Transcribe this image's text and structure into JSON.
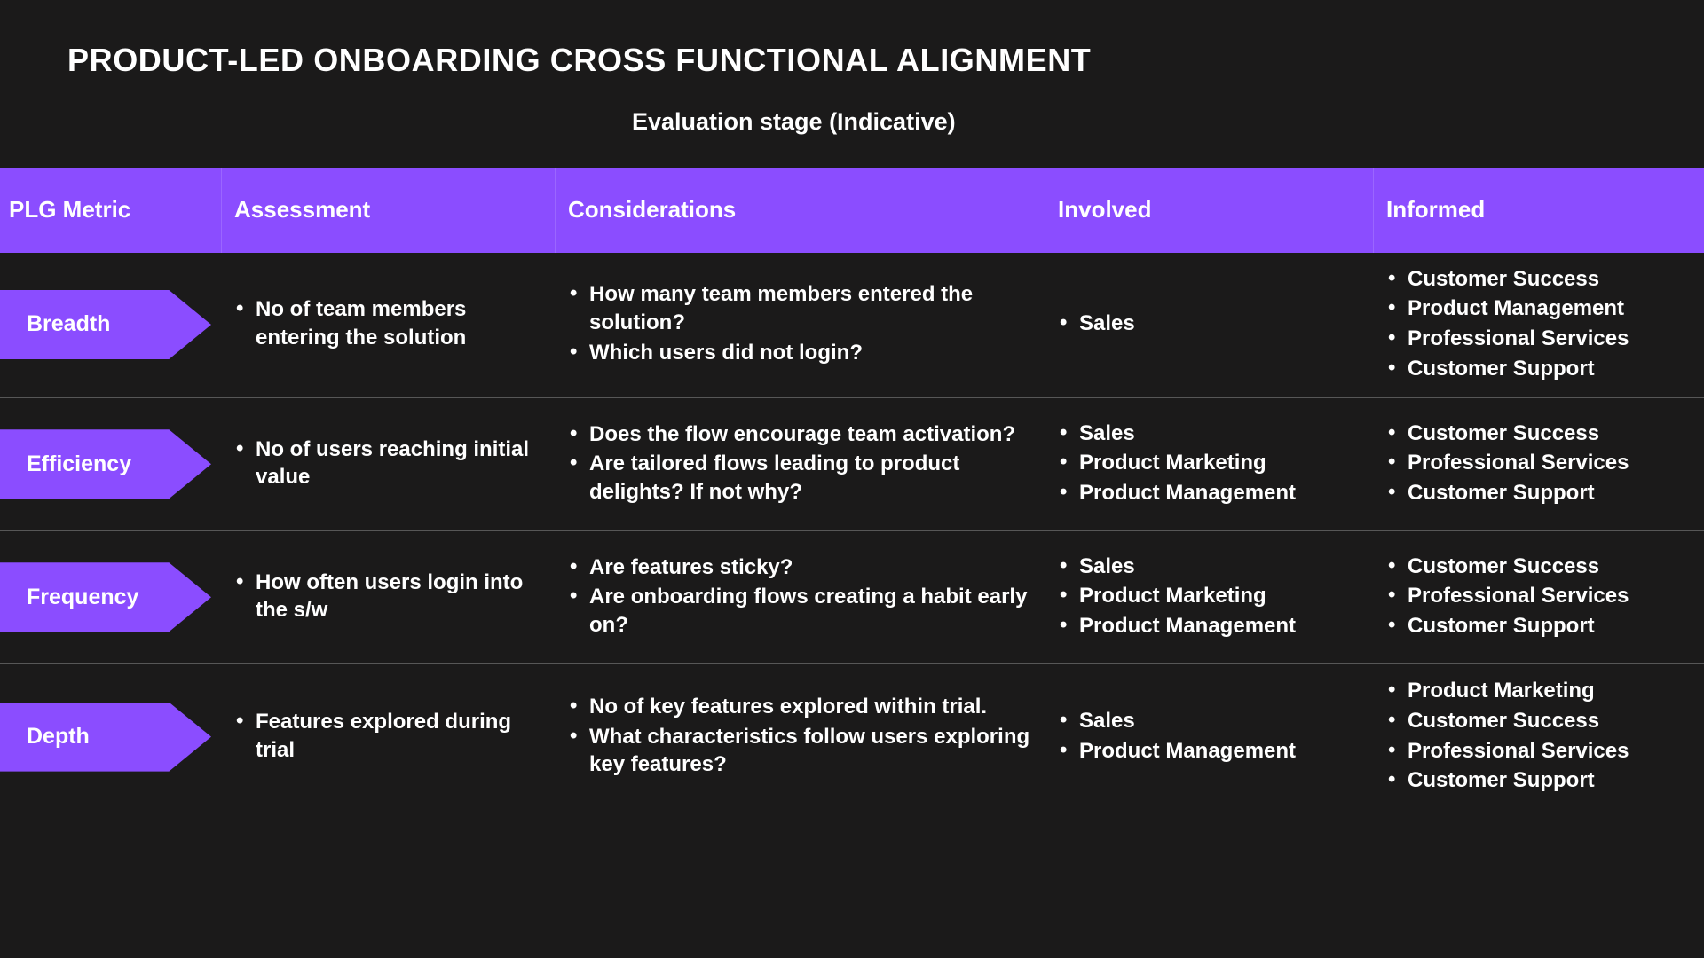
{
  "slide": {
    "title": "PRODUCT-LED ONBOARDING CROSS FUNCTIONAL ALIGNMENT",
    "subtitle": "Evaluation stage (Indicative)",
    "background_color": "#1b1a1a",
    "accent_color": "#8b4dff",
    "text_color": "#ffffff",
    "divider_color": "#575757"
  },
  "table": {
    "headers": [
      {
        "label": "PLG Metric"
      },
      {
        "label": "Assessment"
      },
      {
        "label": "Considerations"
      },
      {
        "label": "Involved"
      },
      {
        "label": "Informed"
      }
    ],
    "rows": [
      {
        "metric": "Breadth",
        "assessment": [
          "No of team members entering the solution"
        ],
        "considerations": [
          "How many team members entered the solution?",
          "Which users did not login?"
        ],
        "involved": [
          "Sales"
        ],
        "informed": [
          "Customer Success",
          "Product Management",
          "Professional Services",
          "Customer Support"
        ]
      },
      {
        "metric": "Efficiency",
        "assessment": [
          "No of users reaching initial value"
        ],
        "considerations": [
          "Does the flow encourage team activation?",
          "Are tailored flows leading to product delights?  If not why?"
        ],
        "involved": [
          "Sales",
          "Product Marketing",
          "Product Management"
        ],
        "informed": [
          "Customer Success",
          "Professional Services",
          "Customer Support"
        ]
      },
      {
        "metric": "Frequency",
        "assessment": [
          "How often users login into the s/w"
        ],
        "considerations": [
          "Are features sticky?",
          "Are onboarding flows creating a habit early on?"
        ],
        "involved": [
          "Sales",
          "Product Marketing",
          "Product Management"
        ],
        "informed": [
          "Customer Success",
          "Professional Services",
          "Customer Support"
        ]
      },
      {
        "metric": "Depth",
        "assessment": [
          "Features explored during trial"
        ],
        "considerations": [
          "No of key features explored within trial.",
          "What characteristics follow users exploring key features?"
        ],
        "involved": [
          "Sales",
          "Product Management"
        ],
        "informed": [
          "Product Marketing",
          "Customer Success",
          "Professional Services",
          "Customer Support"
        ]
      }
    ]
  }
}
